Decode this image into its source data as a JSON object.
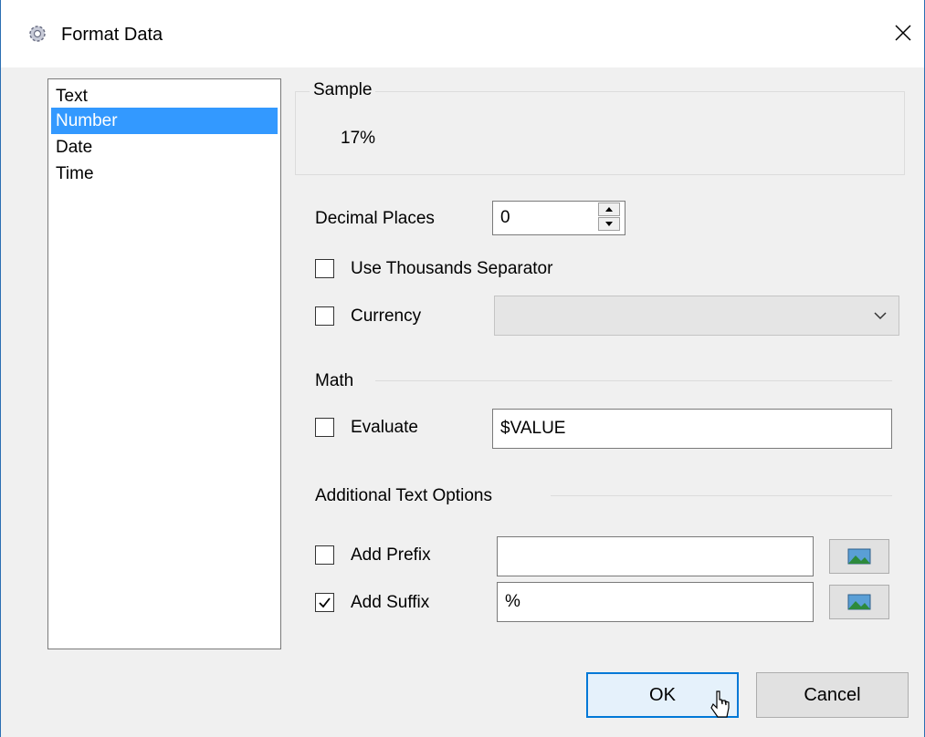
{
  "window": {
    "title": "Format Data"
  },
  "format_list": {
    "items": [
      "Text",
      "Number",
      "Date",
      "Time"
    ],
    "selected": "Number"
  },
  "sample": {
    "label": "Sample",
    "value": "17%"
  },
  "decimal_places": {
    "label": "Decimal Places",
    "value": "0"
  },
  "thousands": {
    "label": "Use Thousands Separator",
    "checked": false
  },
  "currency": {
    "label": "Currency",
    "checked": false,
    "value": ""
  },
  "math": {
    "label": "Math",
    "evaluate_label": "Evaluate",
    "checked": false,
    "expression": "$VALUE"
  },
  "additional": {
    "label": "Additional Text Options",
    "prefix_label": "Add Prefix",
    "prefix_checked": false,
    "prefix_value": "",
    "suffix_label": "Add Suffix",
    "suffix_checked": true,
    "suffix_value": "%"
  },
  "buttons": {
    "ok": "OK",
    "cancel": "Cancel"
  },
  "colors": {
    "accent": "#0078d7",
    "selection": "#3399ff"
  }
}
